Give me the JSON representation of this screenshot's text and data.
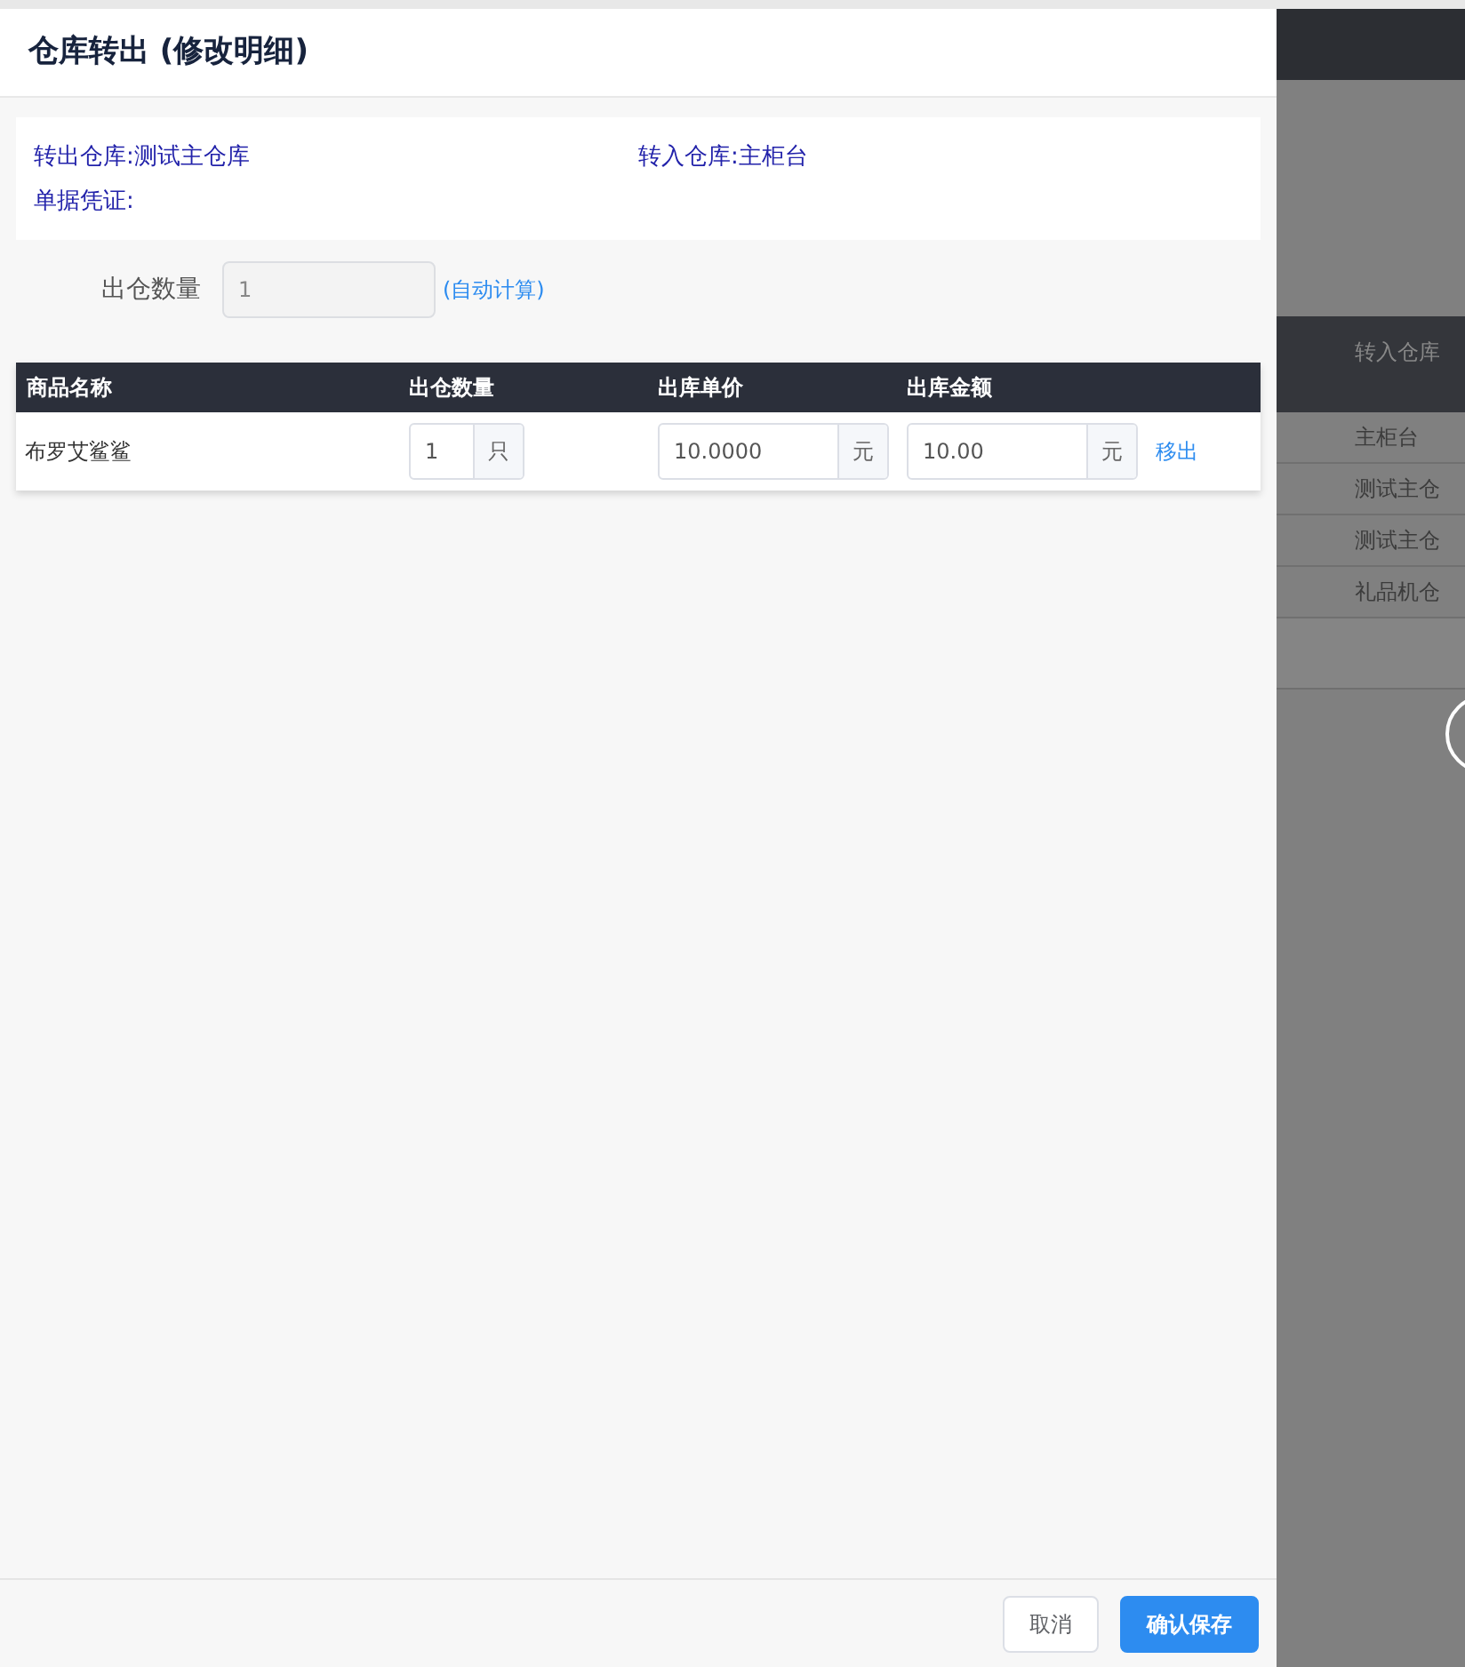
{
  "dialog": {
    "title": "仓库转出 (修改明细)",
    "info": [
      {
        "label": "转出仓库:测试主仓库"
      },
      {
        "label": "转入仓库:主柜台"
      },
      {
        "label": "单据凭证:"
      }
    ],
    "quantity_field": {
      "label": "出仓数量",
      "value": "1",
      "disabled": true,
      "hint": "(自动计算)"
    },
    "table": {
      "columns": [
        "商品名称",
        "出仓数量",
        "出库单价",
        "出库金额"
      ],
      "rows": [
        {
          "name": "布罗艾鲨鲨",
          "quantity": "1",
          "quantity_unit": "只",
          "unit_price": "10.0000",
          "price_unit": "元",
          "amount": "10.00",
          "amount_unit": "元",
          "action": "移出"
        }
      ]
    },
    "buttons": [
      {
        "label": "取消",
        "kind": "secondary"
      },
      {
        "label": "确认保存",
        "kind": "primary"
      }
    ]
  },
  "background": {
    "column_header": "转入仓库",
    "rows": [
      "主柜台",
      "测试主仓",
      "测试主仓",
      "礼品机仓"
    ]
  }
}
